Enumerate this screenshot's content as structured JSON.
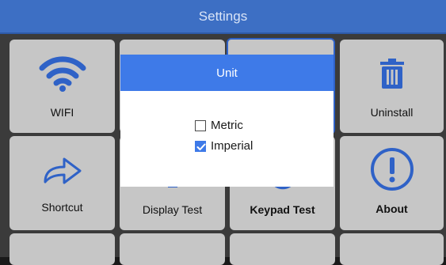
{
  "header": {
    "title": "Settings"
  },
  "tiles": [
    {
      "label": "WIFI",
      "icon": "wifi-icon"
    },
    {
      "label": "",
      "icon": ""
    },
    {
      "label": "",
      "icon": ""
    },
    {
      "label": "Uninstall",
      "icon": "trash-icon"
    },
    {
      "label": "Shortcut",
      "icon": "arrow-right-icon"
    },
    {
      "label": "Display Test",
      "icon": "display-icon"
    },
    {
      "label": "Keypad Test",
      "icon": "keypad-icon"
    },
    {
      "label": "About",
      "icon": "info-exclamation-icon"
    }
  ],
  "dialog": {
    "title": "Unit",
    "options": [
      {
        "label": "Metric",
        "checked": false
      },
      {
        "label": "Imperial",
        "checked": true
      }
    ]
  },
  "colors": {
    "accent": "#3e7ae8",
    "header_bg": "#3d6fc4",
    "tile_bg": "#c6c6c6",
    "grid_bg": "#3b3b3b"
  }
}
